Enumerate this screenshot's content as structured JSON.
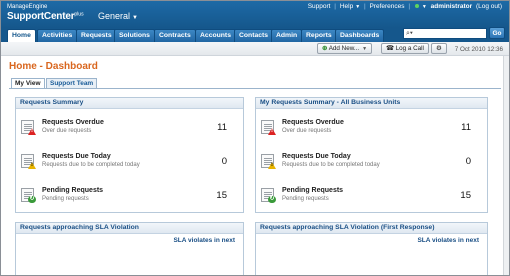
{
  "header": {
    "brand_small": "ManageEngine",
    "brand_main": "SupportCenter",
    "brand_plus": "plus",
    "edition": "General",
    "links": {
      "support": "Support",
      "help": "Help",
      "preferences": "Preferences",
      "user": "administrator",
      "logout": "(Log out)"
    }
  },
  "nav": {
    "tabs": [
      {
        "label": "Home"
      },
      {
        "label": "Activities"
      },
      {
        "label": "Requests"
      },
      {
        "label": "Solutions"
      },
      {
        "label": "Contracts"
      },
      {
        "label": "Accounts"
      },
      {
        "label": "Contacts"
      },
      {
        "label": "Admin"
      },
      {
        "label": "Reports"
      },
      {
        "label": "Dashboards"
      }
    ],
    "go_label": "Go"
  },
  "actions": {
    "add_new": "Add New...",
    "log_call": "Log a Call",
    "datetime": "7 Oct 2010 12:36"
  },
  "page": {
    "title": "Home - Dashboard",
    "view_tabs": [
      "My View",
      "Support Team"
    ]
  },
  "panels": {
    "left_summary": {
      "title": "Requests Summary",
      "items": [
        {
          "title": "Requests Overdue",
          "sub": "Over due requests",
          "count": "11"
        },
        {
          "title": "Requests Due Today",
          "sub": "Requests due to be completed today",
          "count": "0"
        },
        {
          "title": "Pending Requests",
          "sub": "Pending requests",
          "count": "15"
        }
      ]
    },
    "right_summary": {
      "title": "My Requests Summary - All Business Units",
      "items": [
        {
          "title": "Requests Overdue",
          "sub": "Over due requests",
          "count": "11"
        },
        {
          "title": "Requests Due Today",
          "sub": "Requests due to be completed today",
          "count": "0"
        },
        {
          "title": "Pending Requests",
          "sub": "Pending requests",
          "count": "15"
        }
      ]
    },
    "left_sla": {
      "title": "Requests approaching SLA Violation",
      "label": "SLA violates in next"
    },
    "right_sla": {
      "title": "Requests approaching SLA Violation (First Response)",
      "label": "SLA violates in next"
    }
  },
  "colors": {
    "header_blue": "#15578c",
    "title_orange": "#d9661e",
    "panel_title": "#1a4f85"
  }
}
